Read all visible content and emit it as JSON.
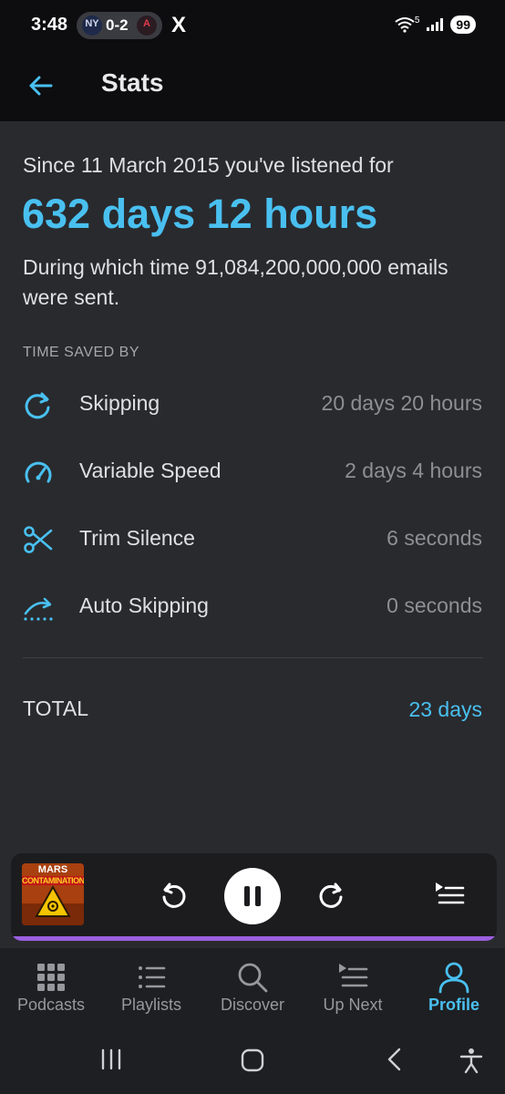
{
  "status_bar": {
    "time": "3:48",
    "score": "0-2",
    "team_left": "NY",
    "team_right": "A",
    "x_label": "X",
    "wifi_badge": "5",
    "battery": "99"
  },
  "header": {
    "title": "Stats",
    "back_icon": "arrow-left-icon"
  },
  "stats": {
    "since_text": "Since 11 March 2015 you've listened for",
    "listen_time": "632 days 12 hours",
    "fun_fact": "During which time 91,084,200,000,000 emails were sent.",
    "section_title": "TIME SAVED BY",
    "rows": [
      {
        "label": "Skipping",
        "value": "20 days 20 hours",
        "icon": "skip-forward-icon"
      },
      {
        "label": "Variable Speed",
        "value": "2 days 4 hours",
        "icon": "speedometer-icon"
      },
      {
        "label": "Trim Silence",
        "value": "6 seconds",
        "icon": "scissors-icon"
      },
      {
        "label": "Auto Skipping",
        "value": "0 seconds",
        "icon": "auto-skip-icon"
      }
    ],
    "total_label": "TOTAL",
    "total_value": "23 days"
  },
  "player": {
    "artwork_title_1": "MARS",
    "artwork_title_2": "CONTAMINATION",
    "progress": 1.0,
    "accent": "#9b5fe0"
  },
  "nav": {
    "items": [
      {
        "label": "Podcasts",
        "icon": "grid-icon"
      },
      {
        "label": "Playlists",
        "icon": "list-icon"
      },
      {
        "label": "Discover",
        "icon": "search-icon"
      },
      {
        "label": "Up Next",
        "icon": "up-next-icon"
      },
      {
        "label": "Profile",
        "icon": "person-icon",
        "active": true
      }
    ]
  },
  "colors": {
    "accent": "#49c0f0",
    "background": "#292a2e",
    "bar": "#0d0d0f"
  }
}
